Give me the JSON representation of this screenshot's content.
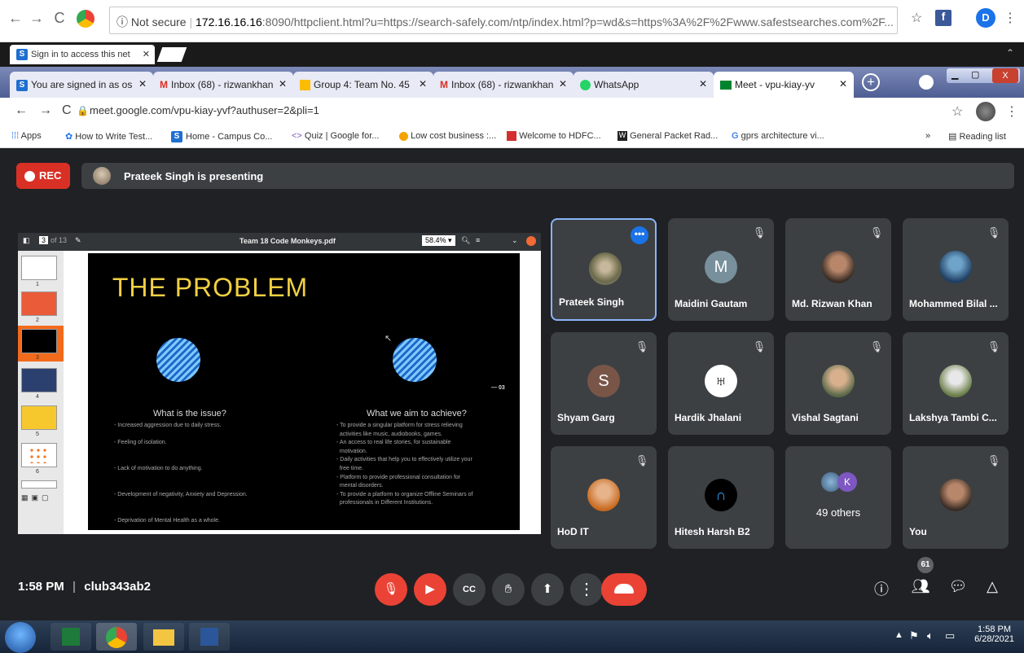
{
  "outer_browser": {
    "omnibox_prefix": "Not secure",
    "omnibox_host": "172.16.16.16",
    "omnibox_path": ":8090/httpclient.html?u=https://search-safely.com/ntp/index.html?p=wd&s=https%3A%2F%2Fwww.safestsearches.com%2F...",
    "tab_title": "Sign in to access this net"
  },
  "tabs": [
    {
      "label": "You are signed in as os",
      "icon": "s-icon"
    },
    {
      "label": "Inbox (68) - rizwankhan",
      "icon": "gmail-icon"
    },
    {
      "label": "Group 4: Team No. 45",
      "icon": "classroom-icon"
    },
    {
      "label": "Inbox (68) - rizwankhan",
      "icon": "gmail-icon"
    },
    {
      "label": "WhatsApp",
      "icon": "whatsapp-icon"
    },
    {
      "label": "Meet - vpu-kiay-yv",
      "icon": "meet-icon"
    }
  ],
  "address_bar": {
    "url": "meet.google.com/vpu-kiay-yvf?authuser=2&pli=1"
  },
  "bookmarks": [
    "Apps",
    "How to Write Test...",
    "Home - Campus Co...",
    "Quiz | Google for...",
    "Low cost business :...",
    "Welcome to HDFC...",
    "General Packet Rad...",
    "gprs architecture vi...",
    "Reading list"
  ],
  "meet": {
    "rec_label": "REC",
    "presenting_text": "Prateek Singh is presenting",
    "pdf": {
      "page": "3",
      "of": "of 13",
      "filename": "Team 18 Code Monkeys.pdf",
      "zoom": "58.4%",
      "thumbnail_numbers": [
        "1",
        "2",
        "3",
        "4",
        "5",
        "6"
      ]
    },
    "slide": {
      "title": "THE PROBLEM",
      "page_marker": "— 03",
      "left_heading": "What is the issue?",
      "left_body": "- Increased aggression due to daily stress.\n\n- Feeling of isolation.\n\n\n- Lack of motivation to do anything.\n\n\n- Development of negativity, Anxiety and Depression.\n\n\n- Deprivation of Mental Health as a whole.",
      "right_heading": "What we aim to achieve?",
      "right_body": "- To provide a singular platform for stress relieving\n  activities like music, audiobooks, games.\n- An access to real life stories, for sustainable\n  motivation.\n- Daily activities that help you to effectively utilize your\n  free time.\n- Platform to provide professional consultation for\n  mental disorders.\n- To provide a platform to organize Offline Seminars of\n  professionals in Different Institutions."
    },
    "participants": [
      {
        "name": "Prateek Singh",
        "avatar": "photo",
        "active": true
      },
      {
        "name": "Maidini Gautam",
        "avatar": "M",
        "color": "#78909c"
      },
      {
        "name": "Md. Rizwan Khan",
        "avatar": "photo"
      },
      {
        "name": "Mohammed Bilal ...",
        "avatar": "photo"
      },
      {
        "name": "Shyam Garg",
        "avatar": "S",
        "color": "#795548"
      },
      {
        "name": "Hardik Jhalani",
        "avatar": "logo"
      },
      {
        "name": "Vishal Sagtani",
        "avatar": "photo"
      },
      {
        "name": "Lakshya Tambi C...",
        "avatar": "photo"
      },
      {
        "name": "HoD IT",
        "avatar": "photo"
      },
      {
        "name": "Hitesh Harsh B2",
        "avatar": "logo"
      },
      {
        "name": "49 others",
        "avatar": "group",
        "group_letter": "K"
      },
      {
        "name": "You",
        "avatar": "photo"
      }
    ],
    "time": "1:58 PM",
    "meeting_code": "club343ab2",
    "people_count": "61"
  },
  "taskbar": {
    "time": "1:58 PM",
    "date": "6/28/2021"
  }
}
